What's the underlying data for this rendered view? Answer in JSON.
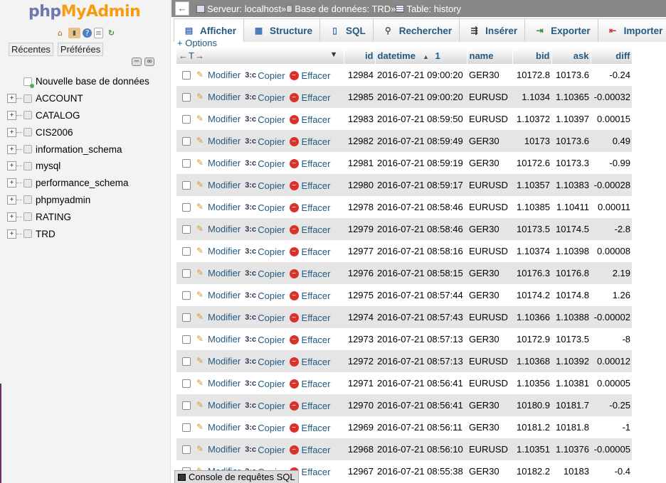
{
  "nav": {
    "logo_php": "php",
    "logo_myadmin": "MyAdmin",
    "tabs": [
      "Récentes",
      "Préférées"
    ],
    "new_db": "Nouvelle base de données",
    "databases": [
      "ACCOUNT",
      "CATALOG",
      "CIS2006",
      "information_schema",
      "mysql",
      "performance_schema",
      "phpmyadmin",
      "RATING",
      "TRD"
    ]
  },
  "breadcrumb": {
    "server": "Serveur: localhost",
    "database": "Base de données: TRD",
    "table": "Table: history"
  },
  "tabs": [
    "Afficher",
    "Structure",
    "SQL",
    "Rechercher",
    "Insérer",
    "Exporter",
    "Importer"
  ],
  "options_link": "+ Options",
  "actions": {
    "edit": "Modifier",
    "copy": "Copier",
    "delete": "Effacer"
  },
  "columns": {
    "id": "id",
    "datetime": "datetime",
    "sort_order": "1",
    "name": "name",
    "bid": "bid",
    "ask": "ask",
    "diff": "diff"
  },
  "rows": [
    [
      "12984",
      "2016-07-21 09:00:20",
      "GER30",
      "10172.8",
      "10173.6",
      "-0.24"
    ],
    [
      "12985",
      "2016-07-21 09:00:20",
      "EURUSD",
      "1.1034",
      "1.10365",
      "-0.00032"
    ],
    [
      "12983",
      "2016-07-21 08:59:50",
      "EURUSD",
      "1.10372",
      "1.10397",
      "0.00015"
    ],
    [
      "12982",
      "2016-07-21 08:59:49",
      "GER30",
      "10173",
      "10173.6",
      "0.49"
    ],
    [
      "12981",
      "2016-07-21 08:59:19",
      "GER30",
      "10172.6",
      "10173.3",
      "-0.99"
    ],
    [
      "12980",
      "2016-07-21 08:59:17",
      "EURUSD",
      "1.10357",
      "1.10383",
      "-0.00028"
    ],
    [
      "12978",
      "2016-07-21 08:58:46",
      "EURUSD",
      "1.10385",
      "1.10411",
      "0.00011"
    ],
    [
      "12979",
      "2016-07-21 08:58:46",
      "GER30",
      "10173.5",
      "10174.5",
      "-2.8"
    ],
    [
      "12977",
      "2016-07-21 08:58:16",
      "EURUSD",
      "1.10374",
      "1.10398",
      "0.00008"
    ],
    [
      "12976",
      "2016-07-21 08:58:15",
      "GER30",
      "10176.3",
      "10176.8",
      "2.19"
    ],
    [
      "12975",
      "2016-07-21 08:57:44",
      "GER30",
      "10174.2",
      "10174.8",
      "1.26"
    ],
    [
      "12974",
      "2016-07-21 08:57:43",
      "EURUSD",
      "1.10366",
      "1.10388",
      "-0.00002"
    ],
    [
      "12973",
      "2016-07-21 08:57:13",
      "GER30",
      "10172.9",
      "10173.5",
      "-8"
    ],
    [
      "12972",
      "2016-07-21 08:57:13",
      "EURUSD",
      "1.10368",
      "1.10392",
      "0.00012"
    ],
    [
      "12971",
      "2016-07-21 08:56:41",
      "EURUSD",
      "1.10356",
      "1.10381",
      "0.00005"
    ],
    [
      "12970",
      "2016-07-21 08:56:41",
      "GER30",
      "10180.9",
      "10181.7",
      "-0.25"
    ],
    [
      "12969",
      "2016-07-21 08:56:11",
      "GER30",
      "10181.2",
      "10181.8",
      "-1"
    ],
    [
      "12968",
      "2016-07-21 08:56:10",
      "EURUSD",
      "1.10351",
      "1.10376",
      "-0.00005"
    ],
    [
      "12967",
      "2016-07-21 08:55:38",
      "GER30",
      "10182.2",
      "10183",
      "-0.4"
    ]
  ],
  "console": "Console de requêtes SQL"
}
